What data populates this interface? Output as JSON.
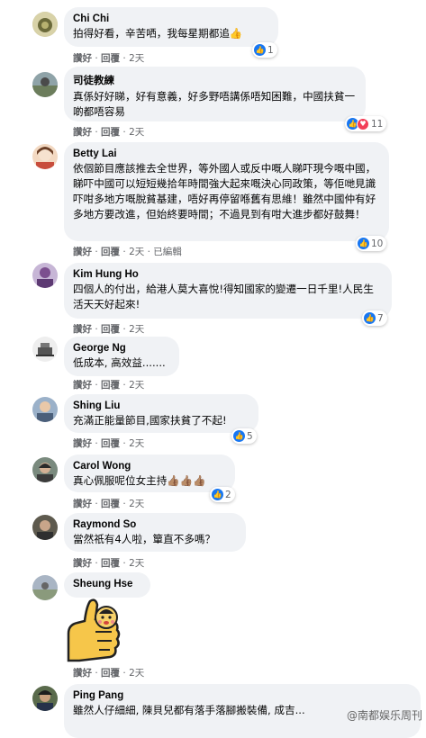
{
  "actions": {
    "like": "讚好",
    "reply": "回覆",
    "sep": "·"
  },
  "comments": [
    {
      "author": "Chi Chi",
      "text": "拍得好看，辛苦哂，我每星期都追👍",
      "time": "2天",
      "reactions": "1"
    },
    {
      "author": "司徒教練",
      "text": "真係好好睇，好有意義，好多野唔講係唔知困難，中國扶貧一啲都唔容易",
      "time": "2天",
      "reactions": "11"
    },
    {
      "author": "Betty Lai",
      "text": "依個節目應該推去全世界，等外國人或反中嘅人睇吓現今嘅中國，睇吓中國可以短短幾拾年時間強大起來嘅決心同政策，等佢哋見識吓咁多地方嘅脫貧基建，唔好再停留喺舊有思維！雖然中國仲有好多地方要改進，但始終要時間；不過見到有咁大進步都好鼓舞！",
      "time": "2天",
      "edited": "已編輯",
      "reactions": "10"
    },
    {
      "author": "Kim Hung Ho",
      "text": "四個人的付出，給港人莫大喜悅!得知國家的變遷一日千里!人民生活天天好起來!",
      "time": "2天",
      "reactions": "7"
    },
    {
      "author": "George Ng",
      "text": "低成本, 高效益.......",
      "time": "2天"
    },
    {
      "author": "Shing Liu",
      "text": "充滿正能量節目,國家扶貧了不起!",
      "time": "2天",
      "reactions": "5"
    },
    {
      "author": "Carol Wong",
      "text": "真心佩服呢位女主持👍🏽👍🏽👍🏽",
      "time": "2天",
      "reactions": "2"
    },
    {
      "author": "Raymond So",
      "text": "當然祇有4人啦，簞直不多嗎？",
      "time": "2天"
    },
    {
      "author": "Sheung Hse",
      "text": "",
      "time": "2天"
    },
    {
      "author": "Ping Pang",
      "text": "雖然人仔細細, 陳貝兒都有落手落腳搬裝備, 成吉...",
      "time": ""
    }
  ],
  "watermark": "@南都娱乐周刊",
  "colors": {
    "bubble": "#f0f2f5",
    "meta": "#65676b",
    "like": "#1877f2",
    "love": "#f33e58"
  }
}
